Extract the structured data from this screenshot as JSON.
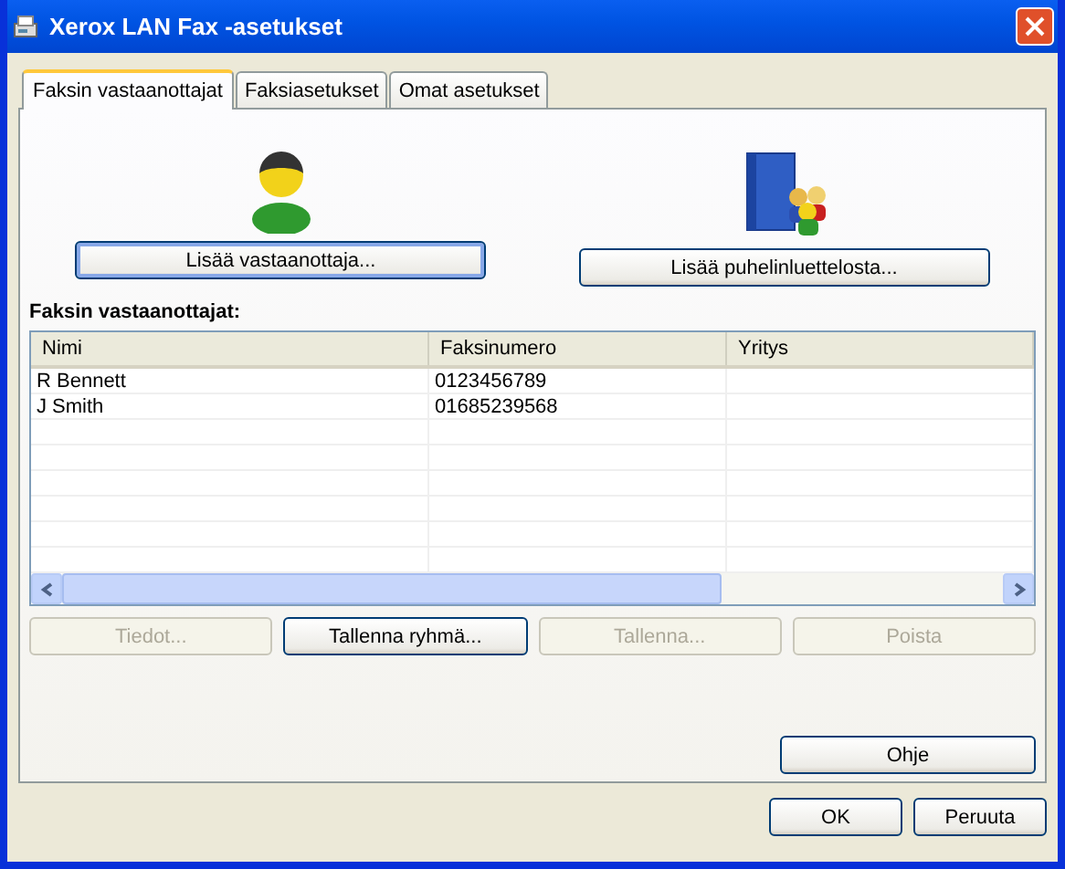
{
  "window": {
    "title": "Xerox LAN Fax -asetukset"
  },
  "tabs": [
    {
      "label": "Faksin vastaanottajat",
      "selected": true
    },
    {
      "label": "Faksiasetukset",
      "selected": false
    },
    {
      "label": "Omat asetukset",
      "selected": false
    }
  ],
  "add_buttons": [
    {
      "kind": "person",
      "label": "Lisää vastaanottaja...",
      "focused": true
    },
    {
      "kind": "phonebook",
      "label": "Lisää puhelinluettelosta...",
      "focused": false
    }
  ],
  "list": {
    "title": "Faksin vastaanottajat:",
    "columns": [
      "Nimi",
      "Faksinumero",
      "Yritys"
    ],
    "rows": [
      [
        "R Bennett",
        "0123456789",
        ""
      ],
      [
        "J Smith",
        "01685239568",
        ""
      ]
    ]
  },
  "list_buttons": [
    {
      "label": "Tiedot...",
      "disabled": true
    },
    {
      "label": "Tallenna ryhmä...",
      "disabled": false
    },
    {
      "label": "Tallenna...",
      "disabled": true
    },
    {
      "label": "Poista",
      "disabled": true
    }
  ],
  "help_button": "Ohje",
  "dialog_buttons": [
    "OK",
    "Peruuta"
  ]
}
